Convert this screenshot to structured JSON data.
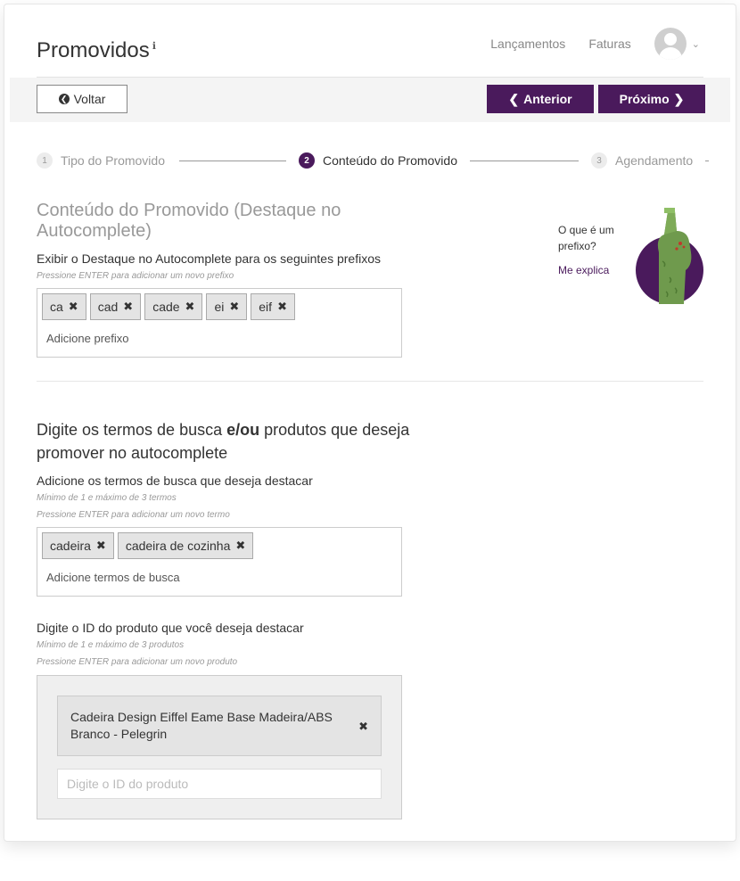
{
  "header": {
    "title": "Promovidos",
    "nav": [
      {
        "label": "Lançamentos"
      },
      {
        "label": "Faturas"
      }
    ]
  },
  "toolbar": {
    "back_label": "Voltar",
    "prev_label": "Anterior",
    "next_label": "Próximo"
  },
  "steps": [
    {
      "num": "1",
      "label": "Tipo do Promovido"
    },
    {
      "num": "2",
      "label": "Conteúdo do Promovido"
    },
    {
      "num": "3",
      "label": "Agendamento"
    }
  ],
  "section1": {
    "title": "Conteúdo do Promovido (Destaque no Autocomplete)",
    "label": "Exibir o Destaque no Autocomplete para os seguintes prefixos",
    "hint": "Pressione ENTER para adicionar um novo prefixo",
    "tags": [
      "ca",
      "cad",
      "cade",
      "ei",
      "eif"
    ],
    "placeholder": "Adicione prefixo"
  },
  "help": {
    "question": "O que é um prefixo?",
    "link": "Me explica"
  },
  "section2": {
    "title_pre": "Digite os termos de busca ",
    "title_bold": "e/ou",
    "title_post": " produtos que deseja promover no autocomplete",
    "terms_label": "Adicione os termos de busca que deseja destacar",
    "terms_hint1": "Mínimo de 1 e máximo de 3 termos",
    "terms_hint2": "Pressione ENTER para adicionar um novo termo",
    "terms": [
      "cadeira",
      "cadeira de cozinha"
    ],
    "terms_placeholder": "Adicione termos de busca",
    "product_label": "Digite o ID do produto que você deseja destacar",
    "product_hint1": "Mínimo de 1 e máximo de 3 produtos",
    "product_hint2": "Pressione ENTER para adicionar um novo produto",
    "product_item": "Cadeira Design Eiffel Eame Base Madeira/ABS Branco - Pelegrin",
    "product_placeholder": "Digite o ID do produto"
  },
  "colors": {
    "accent": "#4a1a5c",
    "illustration_green": "#6f9a4d"
  }
}
